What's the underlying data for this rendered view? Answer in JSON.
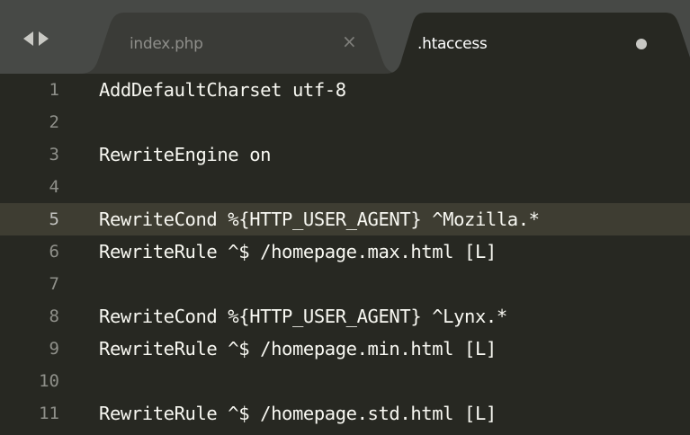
{
  "tabs": [
    {
      "label": "index.php",
      "control": "×",
      "active": false
    },
    {
      "label": ".htaccess",
      "control": "●",
      "active": true
    }
  ],
  "editor": {
    "lines": [
      {
        "number": "1",
        "text": "AddDefaultCharset utf-8"
      },
      {
        "number": "2",
        "text": ""
      },
      {
        "number": "3",
        "text": "RewriteEngine on"
      },
      {
        "number": "4",
        "text": ""
      },
      {
        "number": "5",
        "text": "RewriteCond %{HTTP_USER_AGENT} ^Mozilla.*"
      },
      {
        "number": "6",
        "text": "RewriteRule ^$ /homepage.max.html [L]"
      },
      {
        "number": "7",
        "text": ""
      },
      {
        "number": "8",
        "text": "RewriteCond %{HTTP_USER_AGENT} ^Lynx.*"
      },
      {
        "number": "9",
        "text": "RewriteRule ^$ /homepage.min.html [L]"
      },
      {
        "number": "10",
        "text": ""
      },
      {
        "number": "11",
        "text": "RewriteRule ^$ /homepage.std.html [L]"
      }
    ],
    "current_line": "5"
  },
  "colors": {
    "editor_background": "#272822",
    "tabbar_background": "#474946",
    "active_tab": "#272822",
    "inactive_tab": "#3a3b37",
    "current_line_highlight": "#3e3d32",
    "text": "#f8f8f2",
    "gutter_text": "#8f908a"
  },
  "icons": {
    "nav_back": "triangle-left",
    "nav_forward": "triangle-right",
    "close": "close-x",
    "unsaved": "filled-circle"
  }
}
